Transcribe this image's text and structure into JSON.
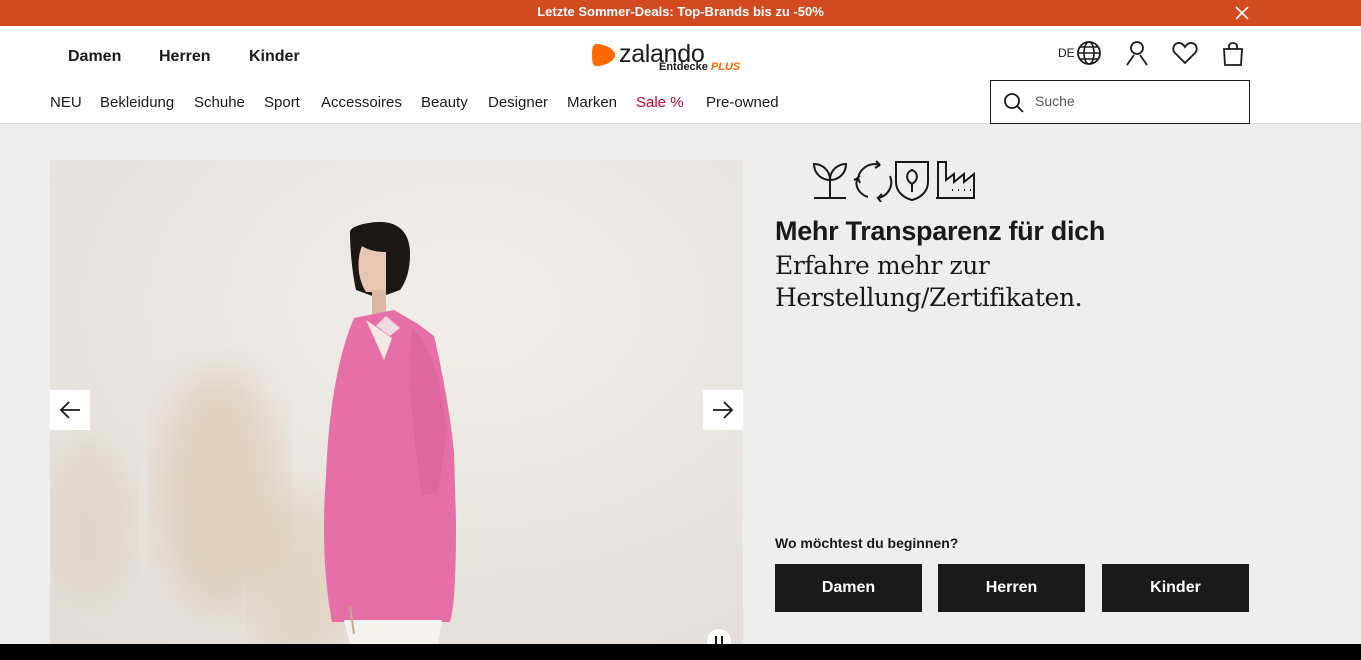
{
  "promo": {
    "text": "Letzte Sommer-Deals: Top-Brands bis zu -50%",
    "bg_color": "#d24a1f"
  },
  "header": {
    "genders": [
      "Damen",
      "Herren",
      "Kinder"
    ],
    "logo": {
      "word": "zalando",
      "sub": "Entdecke",
      "plus": "PLUS"
    },
    "lang": "DE",
    "nav": [
      "NEU",
      "Bekleidung",
      "Schuhe",
      "Sport",
      "Accessoires",
      "Beauty",
      "Designer",
      "Marken",
      "Sale %",
      "Pre-owned"
    ],
    "search_placeholder": "Suche"
  },
  "hero": {
    "title": "Mehr Transparenz für dich",
    "subtitle": "Erfahre mehr zur Herstellung/Zertifikaten.",
    "question": "Wo möchtest du beginnen?",
    "buttons": [
      "Damen",
      "Herren",
      "Kinder"
    ],
    "icons": [
      "plant-icon",
      "recycle-icon",
      "tree-shield-icon",
      "factory-icon"
    ]
  },
  "colors": {
    "sale": "#c4002b",
    "accent": "#ff6900",
    "cta_bg": "#1a1a1a"
  }
}
